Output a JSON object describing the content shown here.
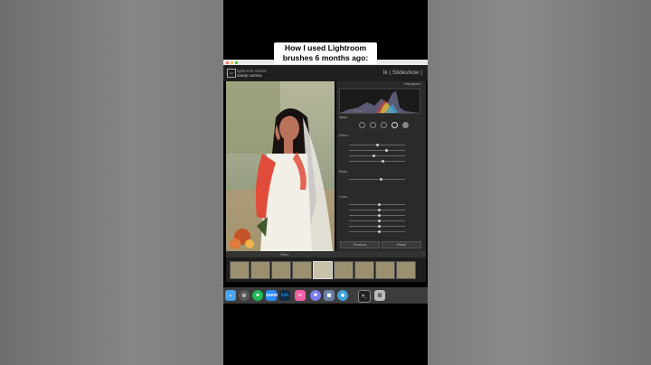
{
  "caption": {
    "line1": "How I used Lightroom",
    "line2": "brushes 6 months ago:"
  },
  "lightroom": {
    "identity_line1": "lightroom classic",
    "identity_line2": "sandy carrera",
    "modules": "lk | Slideshow |",
    "histogram_label": "Histogram",
    "basic_label": "Basic",
    "mask_label": "Mask",
    "effect_label": "Effect",
    "color_label": "Color",
    "prev_button": "Previous",
    "reset_button": "Reset",
    "filter_label": "Filter:"
  },
  "dock": {
    "icons": [
      "finder-icon",
      "chrome-icon",
      "spotify-icon",
      "zoom-icon",
      "lightroom-icon",
      "facetime-icon",
      "settings-icon",
      "photos-icon",
      "preview-icon",
      "terminal-icon",
      "trash-icon"
    ],
    "lr_label": "Lrc",
    "zoom_label": "zoom"
  },
  "colors": {
    "accent_skin": "#c97b63",
    "brush_red": "#e14c3a",
    "dress": "#f4f2ec",
    "panel_bg": "#2a2a2a"
  }
}
